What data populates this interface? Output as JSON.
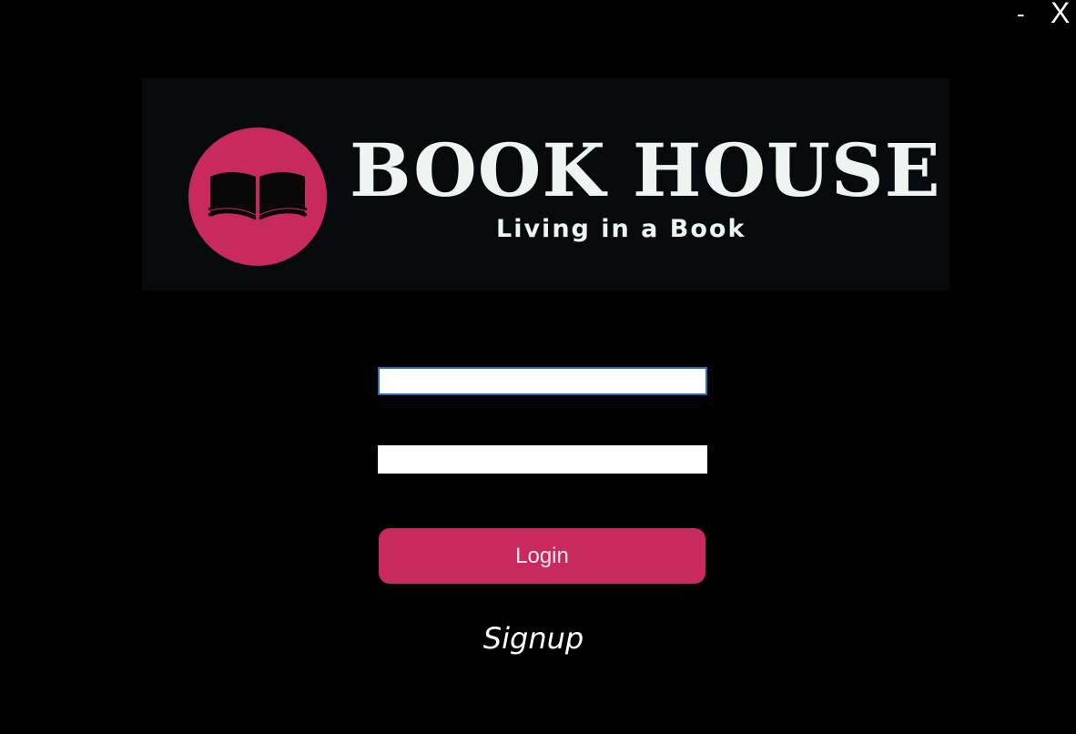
{
  "window": {
    "minimize_label": "-",
    "close_label": "X"
  },
  "banner": {
    "title": "BOOK HOUSE",
    "tagline": "Living in a Book",
    "logo_icon": "open-book-icon"
  },
  "form": {
    "username_value": "",
    "password_value": "",
    "login_label": "Login",
    "signup_label": "Signup"
  },
  "colors": {
    "background": "#000000",
    "banner_background": "#060a0c",
    "accent": "#c92a5d",
    "text": "#eef4f1"
  }
}
